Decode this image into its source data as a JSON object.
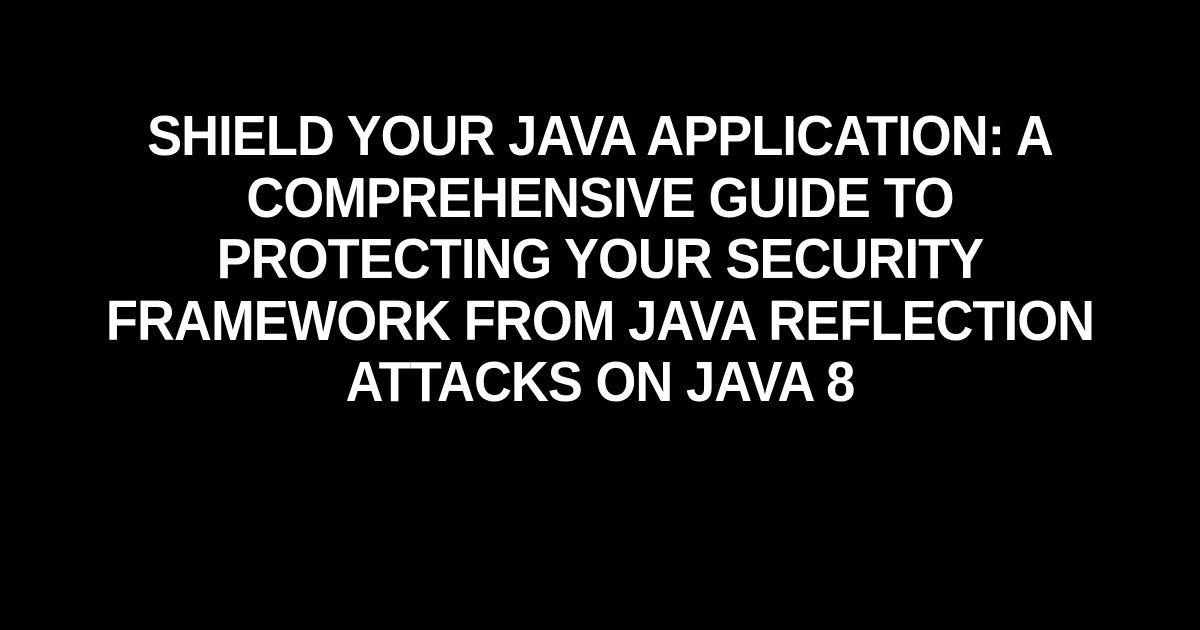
{
  "title": "SHIELD YOUR JAVA APPLICATION: A COMPREHENSIVE GUIDE TO PROTECTING YOUR SECURITY FRAMEWORK FROM JAVA REFLECTION ATTACKS ON JAVA 8"
}
